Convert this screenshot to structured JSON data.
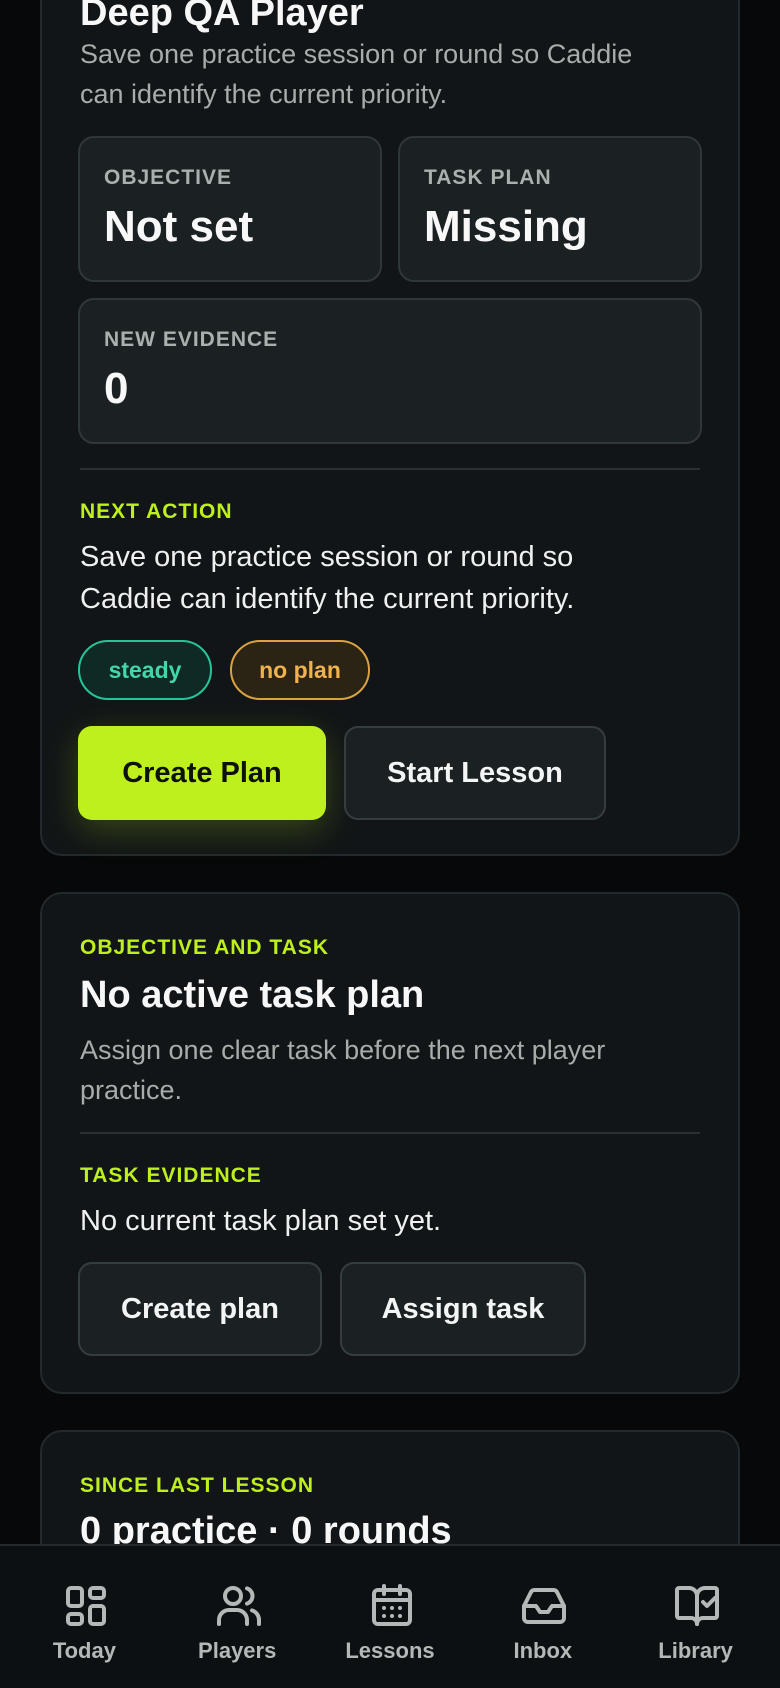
{
  "player_card": {
    "name": "Deep QA Player",
    "summary": "Save one practice session or round so Caddie can identify the current priority.",
    "stats": [
      {
        "label": "OBJECTIVE",
        "value": "Not set"
      },
      {
        "label": "TASK PLAN",
        "value": "Missing"
      },
      {
        "label": "NEW EVIDENCE",
        "value": "0"
      }
    ],
    "next_action_label": "NEXT ACTION",
    "next_action_line1": "Save one practice session or round so",
    "next_action_line2": "Caddie can identify the current priority.",
    "pills": [
      "steady",
      "no plan"
    ],
    "primary_button": "Create Plan",
    "secondary_button": "Start Lesson"
  },
  "task_card": {
    "kicker": "OBJECTIVE AND TASK",
    "title": "No active task plan",
    "desc_line1": "Assign one clear task before the next player",
    "desc_line2": "practice.",
    "evidence_label": "TASK EVIDENCE",
    "evidence_text": "No current task plan set yet.",
    "create_button": "Create plan",
    "assign_button": "Assign task"
  },
  "since_card": {
    "kicker": "SINCE LAST LESSON",
    "title": "0 practice · 0 rounds"
  },
  "tabbar": {
    "items": [
      {
        "label": "Today",
        "icon": "grid-icon"
      },
      {
        "label": "Players",
        "icon": "users-icon"
      },
      {
        "label": "Lessons",
        "icon": "calendar-icon"
      },
      {
        "label": "Inbox",
        "icon": "inbox-icon"
      },
      {
        "label": "Library",
        "icon": "book-check-icon"
      }
    ]
  },
  "colors": {
    "accent": "#bdf01c",
    "steady": "#43d6a8",
    "no_plan": "#f0b24c"
  }
}
